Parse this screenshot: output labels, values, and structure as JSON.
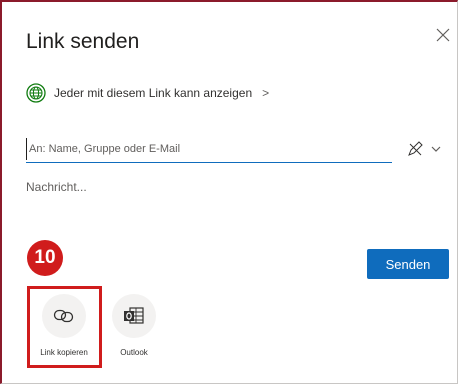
{
  "dialog": {
    "title": "Link senden",
    "permission": {
      "label": "Jeder mit diesem Link kann anzeigen",
      "chevron": ">"
    },
    "recipient": {
      "placeholder": "An: Name, Gruppe oder E-Mail",
      "value": ""
    },
    "message": {
      "placeholder": "Nachricht...",
      "value": ""
    },
    "send_label": "Senden",
    "step_badge": "10",
    "share_options": [
      {
        "label": "Link kopieren",
        "icon": "link-icon"
      },
      {
        "label": "Outlook",
        "icon": "outlook-icon"
      }
    ]
  },
  "colors": {
    "accent": "#0f6cbd",
    "badge": "#d01c1c",
    "globe": "#107c10"
  }
}
